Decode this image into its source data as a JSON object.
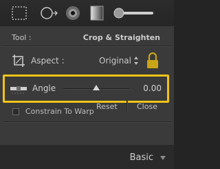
{
  "toolstrip": {
    "tools": [
      "crop-overlay-icon",
      "spot-removal-icon",
      "red-eye-icon",
      "graduated-filter-icon",
      "adjustment-brush-icon"
    ]
  },
  "crop_panel": {
    "tool_label": "Tool :",
    "tool_name": "Crop & Straighten",
    "aspect_label": "Aspect :",
    "aspect_value": "Original",
    "angle_label": "Angle",
    "angle_value": "0.00",
    "angle_slider_fraction": 0.5,
    "constrain_label": "Constrain To Warp",
    "constrain_checked": false,
    "reset_label": "Reset",
    "close_label": "Close"
  },
  "basic_panel": {
    "label": "Basic"
  },
  "colors": {
    "highlight": "#f0c419",
    "panel_bg": "#3a3a3a",
    "background": "#242424"
  }
}
